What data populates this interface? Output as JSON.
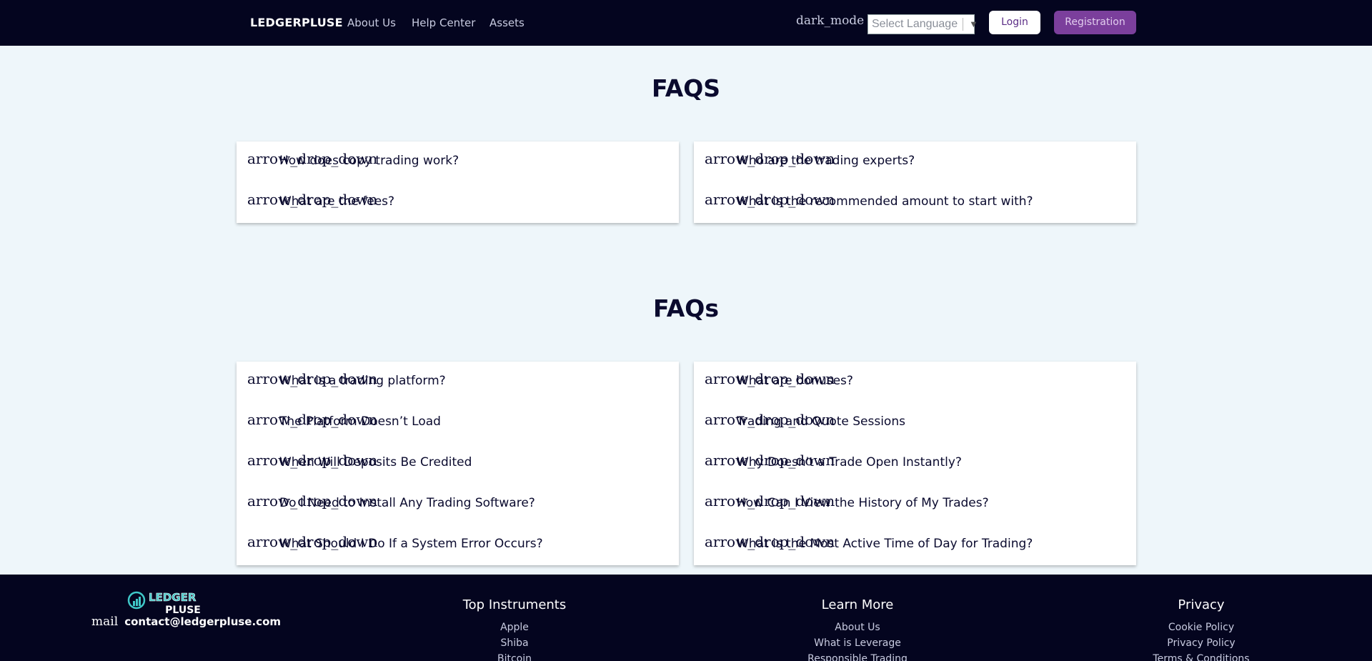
{
  "nav": {
    "brand": "LEDGERPLUSE",
    "links": [
      "About Us",
      "Help Center",
      "Assets"
    ],
    "dark_mode_icon": "dark_mode",
    "language": {
      "selected": "Select Language",
      "caret": "▼"
    },
    "login_label": "Login",
    "register_label": "Registration"
  },
  "faqs1": {
    "title": "FAQS",
    "left": [
      {
        "icon": "arrow_drop_down",
        "question": "How does copy trading work?"
      },
      {
        "icon": "arrow_drop_down",
        "question": "What are the fees?"
      }
    ],
    "right": [
      {
        "icon": "arrow_drop_down",
        "question": "Who are the trading experts?"
      },
      {
        "icon": "arrow_drop_down",
        "question": "What is the recommended amount to start with?"
      }
    ]
  },
  "faqs2": {
    "title": "FAQs",
    "left": [
      {
        "icon": "arrow_drop_down",
        "question": "What is a trading platform?"
      },
      {
        "icon": "arrow_drop_down",
        "question": "The Platform Doesn’t Load"
      },
      {
        "icon": "arrow_drop_down",
        "question": "When Will Deposits Be Credited"
      },
      {
        "icon": "arrow_drop_down",
        "question": "Do I Need to Install Any Trading Software?"
      },
      {
        "icon": "arrow_drop_down",
        "question": "What Should I Do If a System Error Occurs?"
      }
    ],
    "right": [
      {
        "icon": "arrow_drop_down",
        "question": "What are bonuses?"
      },
      {
        "icon": "arrow_drop_down",
        "question": "Trading and Quote Sessions"
      },
      {
        "icon": "arrow_drop_down",
        "question": "Why Doesn't a Trade Open Instantly?"
      },
      {
        "icon": "arrow_drop_down",
        "question": "How Can I View the History of My Trades?"
      },
      {
        "icon": "arrow_drop_down",
        "question": "What is the Most Active Time of Day for Trading?"
      }
    ]
  },
  "footer": {
    "logo_text_top": "LEDGER",
    "logo_text_bottom": "PLUSE",
    "mail_icon": "mail",
    "email": "contact@ledgerpluse.com",
    "columns": [
      {
        "title": "Top Instruments",
        "links": [
          "Apple",
          "Shiba",
          "Bitcoin"
        ]
      },
      {
        "title": "Learn More",
        "links": [
          "About Us",
          "What is Leverage",
          "Responsible Trading"
        ]
      },
      {
        "title": "Privacy",
        "links": [
          "Cookie Policy",
          "Privacy Policy",
          "Terms & Conditions"
        ]
      }
    ]
  },
  "colors": {
    "nav_bg": "#04051f",
    "page_bg": "#eef6fa",
    "accent": "#7b3f9c",
    "logo_teal": "#3fc8c8"
  }
}
